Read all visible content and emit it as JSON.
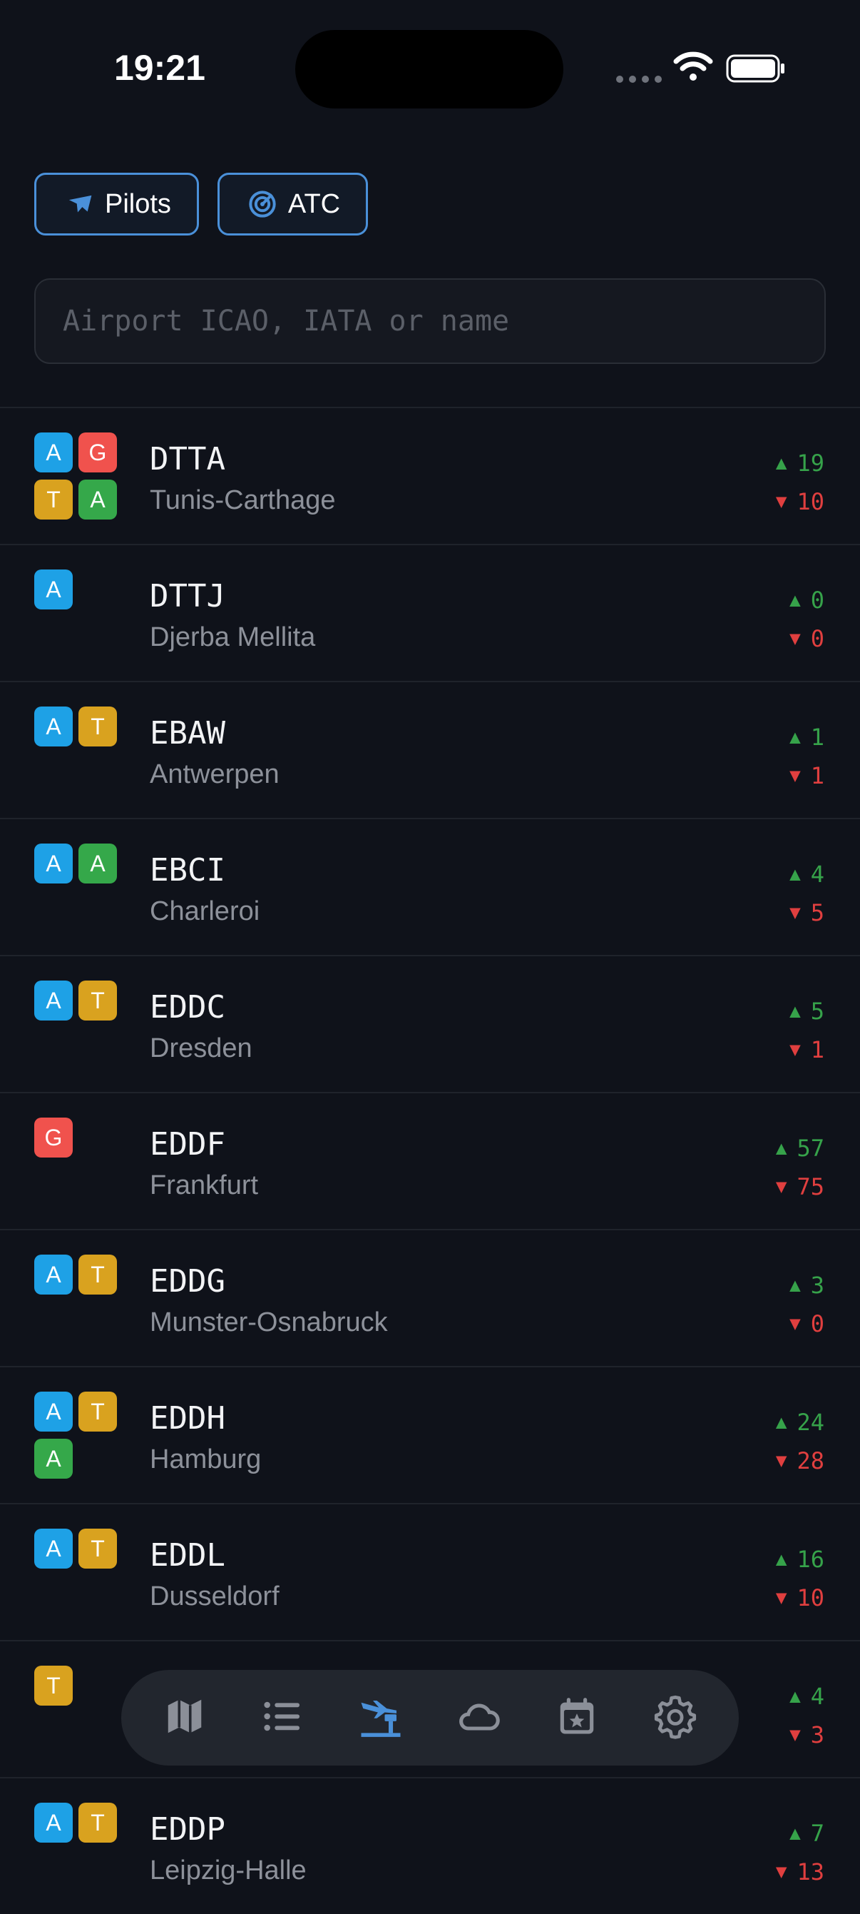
{
  "status": {
    "time": "19:21"
  },
  "filters": {
    "pilots": "Pilots",
    "atc": "ATC"
  },
  "search": {
    "placeholder": "Airport ICAO, IATA or name"
  },
  "colors": {
    "badge_A": "#1ea1e6",
    "badge_G": "#f0524d",
    "badge_T": "#d9a21f",
    "badge_A2": "#35a84a",
    "up": "#36a24a",
    "down": "#e03f3f",
    "accent": "#4a90d9"
  },
  "airports": [
    {
      "code": "DTTA",
      "name": "Tunis-Carthage",
      "badges": [
        {
          "t": "A",
          "c": "#1ea1e6"
        },
        {
          "t": "G",
          "c": "#f0524d"
        },
        {
          "t": "T",
          "c": "#d9a21f"
        },
        {
          "t": "A",
          "c": "#35a84a"
        }
      ],
      "dep": "19",
      "arr": "10"
    },
    {
      "code": "DTTJ",
      "name": "Djerba Mellita",
      "badges": [
        {
          "t": "A",
          "c": "#1ea1e6"
        }
      ],
      "dep": "0",
      "arr": "0"
    },
    {
      "code": "EBAW",
      "name": "Antwerpen",
      "badges": [
        {
          "t": "A",
          "c": "#1ea1e6"
        },
        {
          "t": "T",
          "c": "#d9a21f"
        }
      ],
      "dep": "1",
      "arr": "1"
    },
    {
      "code": "EBCI",
      "name": "Charleroi",
      "badges": [
        {
          "t": "A",
          "c": "#1ea1e6"
        },
        {
          "t": "A",
          "c": "#35a84a"
        }
      ],
      "dep": "4",
      "arr": "5"
    },
    {
      "code": "EDDC",
      "name": "Dresden",
      "badges": [
        {
          "t": "A",
          "c": "#1ea1e6"
        },
        {
          "t": "T",
          "c": "#d9a21f"
        }
      ],
      "dep": "5",
      "arr": "1"
    },
    {
      "code": "EDDF",
      "name": "Frankfurt",
      "badges": [
        {
          "t": "G",
          "c": "#f0524d"
        }
      ],
      "dep": "57",
      "arr": "75"
    },
    {
      "code": "EDDG",
      "name": "Munster-Osnabruck",
      "badges": [
        {
          "t": "A",
          "c": "#1ea1e6"
        },
        {
          "t": "T",
          "c": "#d9a21f"
        }
      ],
      "dep": "3",
      "arr": "0"
    },
    {
      "code": "EDDH",
      "name": "Hamburg",
      "badges": [
        {
          "t": "A",
          "c": "#1ea1e6"
        },
        {
          "t": "T",
          "c": "#d9a21f"
        },
        {
          "t": "A",
          "c": "#35a84a"
        }
      ],
      "dep": "24",
      "arr": "28"
    },
    {
      "code": "EDDL",
      "name": "Dusseldorf",
      "badges": [
        {
          "t": "A",
          "c": "#1ea1e6"
        },
        {
          "t": "T",
          "c": "#d9a21f"
        }
      ],
      "dep": "16",
      "arr": "10"
    },
    {
      "code": "",
      "name": "",
      "badges": [
        {
          "t": "T",
          "c": "#d9a21f"
        }
      ],
      "dep": "4",
      "arr": "3"
    },
    {
      "code": "EDDP",
      "name": "Leipzig-Halle",
      "badges": [
        {
          "t": "A",
          "c": "#1ea1e6"
        },
        {
          "t": "T",
          "c": "#d9a21f"
        }
      ],
      "dep": "7",
      "arr": "13"
    }
  ],
  "tabs": [
    {
      "icon": "map-icon",
      "active": false
    },
    {
      "icon": "list-icon",
      "active": false
    },
    {
      "icon": "airport-icon",
      "active": true
    },
    {
      "icon": "weather-icon",
      "active": false
    },
    {
      "icon": "events-calendar-icon",
      "active": false
    },
    {
      "icon": "settings-gear-icon",
      "active": false
    }
  ]
}
